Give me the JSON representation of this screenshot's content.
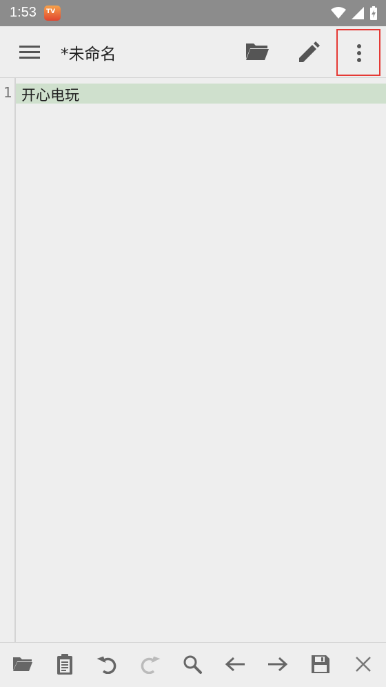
{
  "status": {
    "time": "1:53",
    "app_badge": "TV"
  },
  "toolbar": {
    "title": "*未命名"
  },
  "editor": {
    "lines": [
      {
        "number": "1",
        "text": "开心电玩"
      }
    ]
  },
  "colors": {
    "highlight": "#cfe0cd",
    "focus_box": "#e53935"
  },
  "icons": [
    "menu-icon",
    "folder-open-icon",
    "pencil-icon",
    "more-vert-icon",
    "folder-icon",
    "clipboard-icon",
    "undo-icon",
    "redo-icon",
    "search-icon",
    "arrow-left-icon",
    "arrow-right-icon",
    "save-icon",
    "close-icon"
  ]
}
